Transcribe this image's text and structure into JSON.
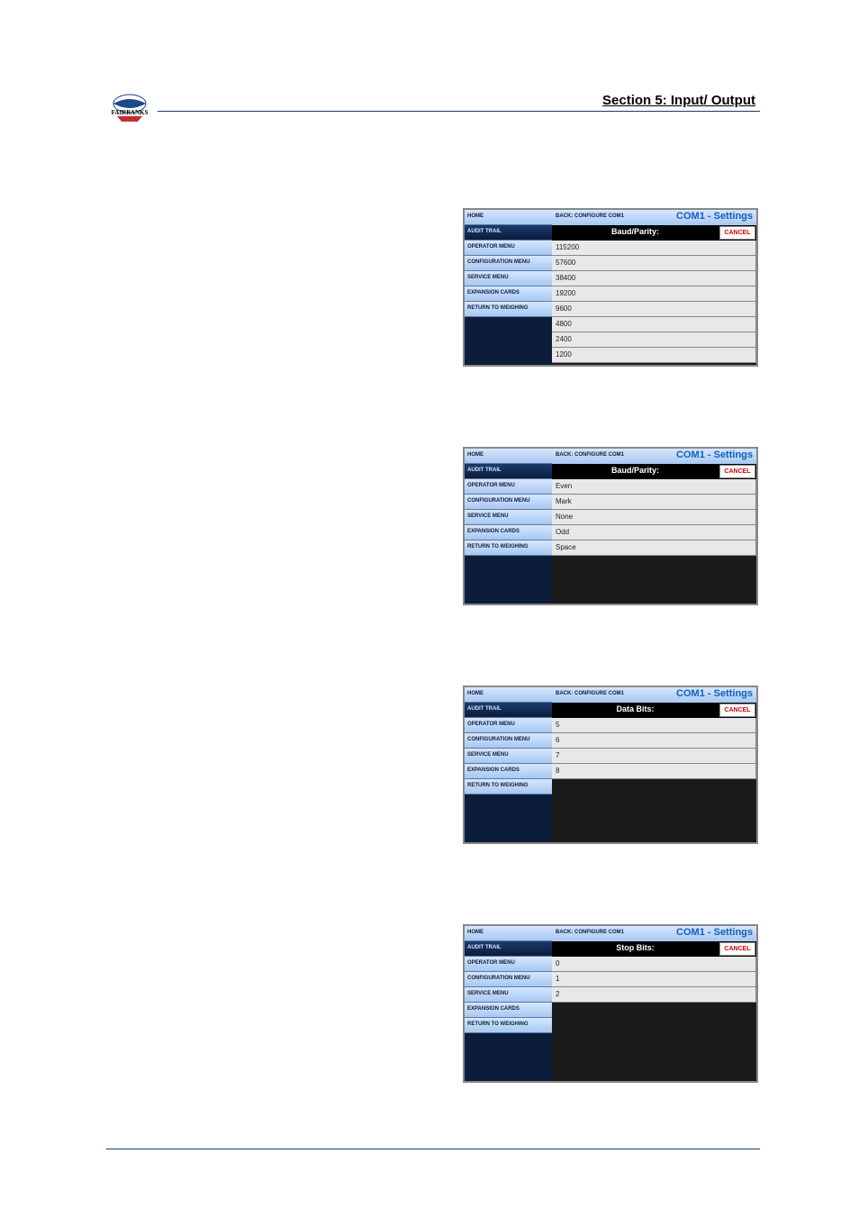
{
  "header": {
    "section_title": "Section 5: Input/ Output"
  },
  "sidebar": {
    "items": [
      "HOME",
      "AUDIT TRAIL",
      "OPERATOR MENU",
      "CONFIGURATION MENU",
      "SERVICE MENU",
      "EXPANSION CARDS",
      "RETURN TO WEIGHING"
    ]
  },
  "panels": [
    {
      "back": "BACK: CONFIGURE COM1",
      "title": "COM1 - Settings",
      "sublabel": "Baud/Parity:",
      "cancel": "CANCEL",
      "options": [
        "115200",
        "57600",
        "38400",
        "19200",
        "9600",
        "4800",
        "2400",
        "1200"
      ]
    },
    {
      "back": "BACK: CONFIGURE COM1",
      "title": "COM1 - Settings",
      "sublabel": "Baud/Parity:",
      "cancel": "CANCEL",
      "options": [
        "Even",
        "Mark",
        "None",
        "Odd",
        "Space"
      ]
    },
    {
      "back": "BACK: CONFIGURE COM1",
      "title": "COM1 - Settings",
      "sublabel": "Data Bits:",
      "cancel": "CANCEL",
      "options": [
        "5",
        "6",
        "7",
        "8"
      ]
    },
    {
      "back": "BACK: CONFIGURE COM1",
      "title": "COM1 - Settings",
      "sublabel": "Stop Bits:",
      "cancel": "CANCEL",
      "options": [
        "0",
        "1",
        "2"
      ]
    }
  ]
}
